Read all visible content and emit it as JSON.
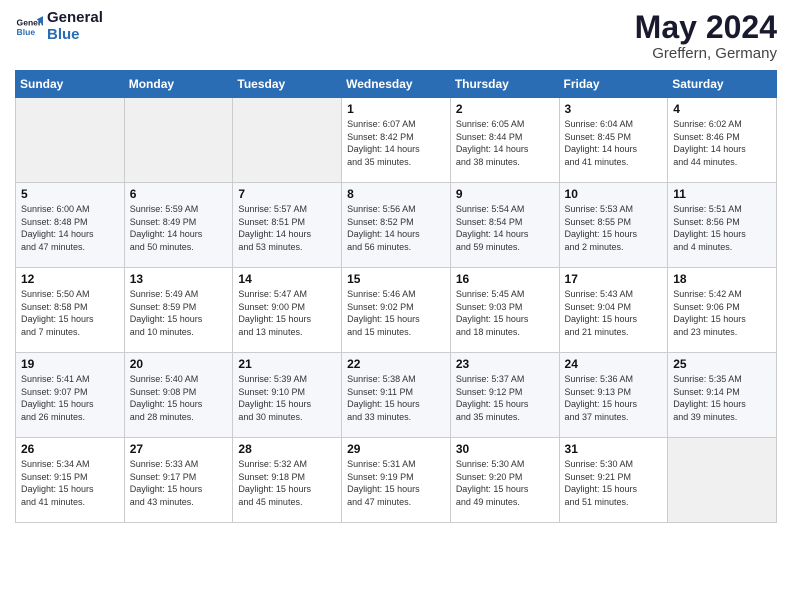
{
  "header": {
    "logo_line1": "General",
    "logo_line2": "Blue",
    "month": "May 2024",
    "location": "Greffern, Germany"
  },
  "weekdays": [
    "Sunday",
    "Monday",
    "Tuesday",
    "Wednesday",
    "Thursday",
    "Friday",
    "Saturday"
  ],
  "weeks": [
    [
      {
        "day": "",
        "content": ""
      },
      {
        "day": "",
        "content": ""
      },
      {
        "day": "",
        "content": ""
      },
      {
        "day": "1",
        "content": "Sunrise: 6:07 AM\nSunset: 8:42 PM\nDaylight: 14 hours\nand 35 minutes."
      },
      {
        "day": "2",
        "content": "Sunrise: 6:05 AM\nSunset: 8:44 PM\nDaylight: 14 hours\nand 38 minutes."
      },
      {
        "day": "3",
        "content": "Sunrise: 6:04 AM\nSunset: 8:45 PM\nDaylight: 14 hours\nand 41 minutes."
      },
      {
        "day": "4",
        "content": "Sunrise: 6:02 AM\nSunset: 8:46 PM\nDaylight: 14 hours\nand 44 minutes."
      }
    ],
    [
      {
        "day": "5",
        "content": "Sunrise: 6:00 AM\nSunset: 8:48 PM\nDaylight: 14 hours\nand 47 minutes."
      },
      {
        "day": "6",
        "content": "Sunrise: 5:59 AM\nSunset: 8:49 PM\nDaylight: 14 hours\nand 50 minutes."
      },
      {
        "day": "7",
        "content": "Sunrise: 5:57 AM\nSunset: 8:51 PM\nDaylight: 14 hours\nand 53 minutes."
      },
      {
        "day": "8",
        "content": "Sunrise: 5:56 AM\nSunset: 8:52 PM\nDaylight: 14 hours\nand 56 minutes."
      },
      {
        "day": "9",
        "content": "Sunrise: 5:54 AM\nSunset: 8:54 PM\nDaylight: 14 hours\nand 59 minutes."
      },
      {
        "day": "10",
        "content": "Sunrise: 5:53 AM\nSunset: 8:55 PM\nDaylight: 15 hours\nand 2 minutes."
      },
      {
        "day": "11",
        "content": "Sunrise: 5:51 AM\nSunset: 8:56 PM\nDaylight: 15 hours\nand 4 minutes."
      }
    ],
    [
      {
        "day": "12",
        "content": "Sunrise: 5:50 AM\nSunset: 8:58 PM\nDaylight: 15 hours\nand 7 minutes."
      },
      {
        "day": "13",
        "content": "Sunrise: 5:49 AM\nSunset: 8:59 PM\nDaylight: 15 hours\nand 10 minutes."
      },
      {
        "day": "14",
        "content": "Sunrise: 5:47 AM\nSunset: 9:00 PM\nDaylight: 15 hours\nand 13 minutes."
      },
      {
        "day": "15",
        "content": "Sunrise: 5:46 AM\nSunset: 9:02 PM\nDaylight: 15 hours\nand 15 minutes."
      },
      {
        "day": "16",
        "content": "Sunrise: 5:45 AM\nSunset: 9:03 PM\nDaylight: 15 hours\nand 18 minutes."
      },
      {
        "day": "17",
        "content": "Sunrise: 5:43 AM\nSunset: 9:04 PM\nDaylight: 15 hours\nand 21 minutes."
      },
      {
        "day": "18",
        "content": "Sunrise: 5:42 AM\nSunset: 9:06 PM\nDaylight: 15 hours\nand 23 minutes."
      }
    ],
    [
      {
        "day": "19",
        "content": "Sunrise: 5:41 AM\nSunset: 9:07 PM\nDaylight: 15 hours\nand 26 minutes."
      },
      {
        "day": "20",
        "content": "Sunrise: 5:40 AM\nSunset: 9:08 PM\nDaylight: 15 hours\nand 28 minutes."
      },
      {
        "day": "21",
        "content": "Sunrise: 5:39 AM\nSunset: 9:10 PM\nDaylight: 15 hours\nand 30 minutes."
      },
      {
        "day": "22",
        "content": "Sunrise: 5:38 AM\nSunset: 9:11 PM\nDaylight: 15 hours\nand 33 minutes."
      },
      {
        "day": "23",
        "content": "Sunrise: 5:37 AM\nSunset: 9:12 PM\nDaylight: 15 hours\nand 35 minutes."
      },
      {
        "day": "24",
        "content": "Sunrise: 5:36 AM\nSunset: 9:13 PM\nDaylight: 15 hours\nand 37 minutes."
      },
      {
        "day": "25",
        "content": "Sunrise: 5:35 AM\nSunset: 9:14 PM\nDaylight: 15 hours\nand 39 minutes."
      }
    ],
    [
      {
        "day": "26",
        "content": "Sunrise: 5:34 AM\nSunset: 9:15 PM\nDaylight: 15 hours\nand 41 minutes."
      },
      {
        "day": "27",
        "content": "Sunrise: 5:33 AM\nSunset: 9:17 PM\nDaylight: 15 hours\nand 43 minutes."
      },
      {
        "day": "28",
        "content": "Sunrise: 5:32 AM\nSunset: 9:18 PM\nDaylight: 15 hours\nand 45 minutes."
      },
      {
        "day": "29",
        "content": "Sunrise: 5:31 AM\nSunset: 9:19 PM\nDaylight: 15 hours\nand 47 minutes."
      },
      {
        "day": "30",
        "content": "Sunrise: 5:30 AM\nSunset: 9:20 PM\nDaylight: 15 hours\nand 49 minutes."
      },
      {
        "day": "31",
        "content": "Sunrise: 5:30 AM\nSunset: 9:21 PM\nDaylight: 15 hours\nand 51 minutes."
      },
      {
        "day": "",
        "content": ""
      }
    ]
  ]
}
